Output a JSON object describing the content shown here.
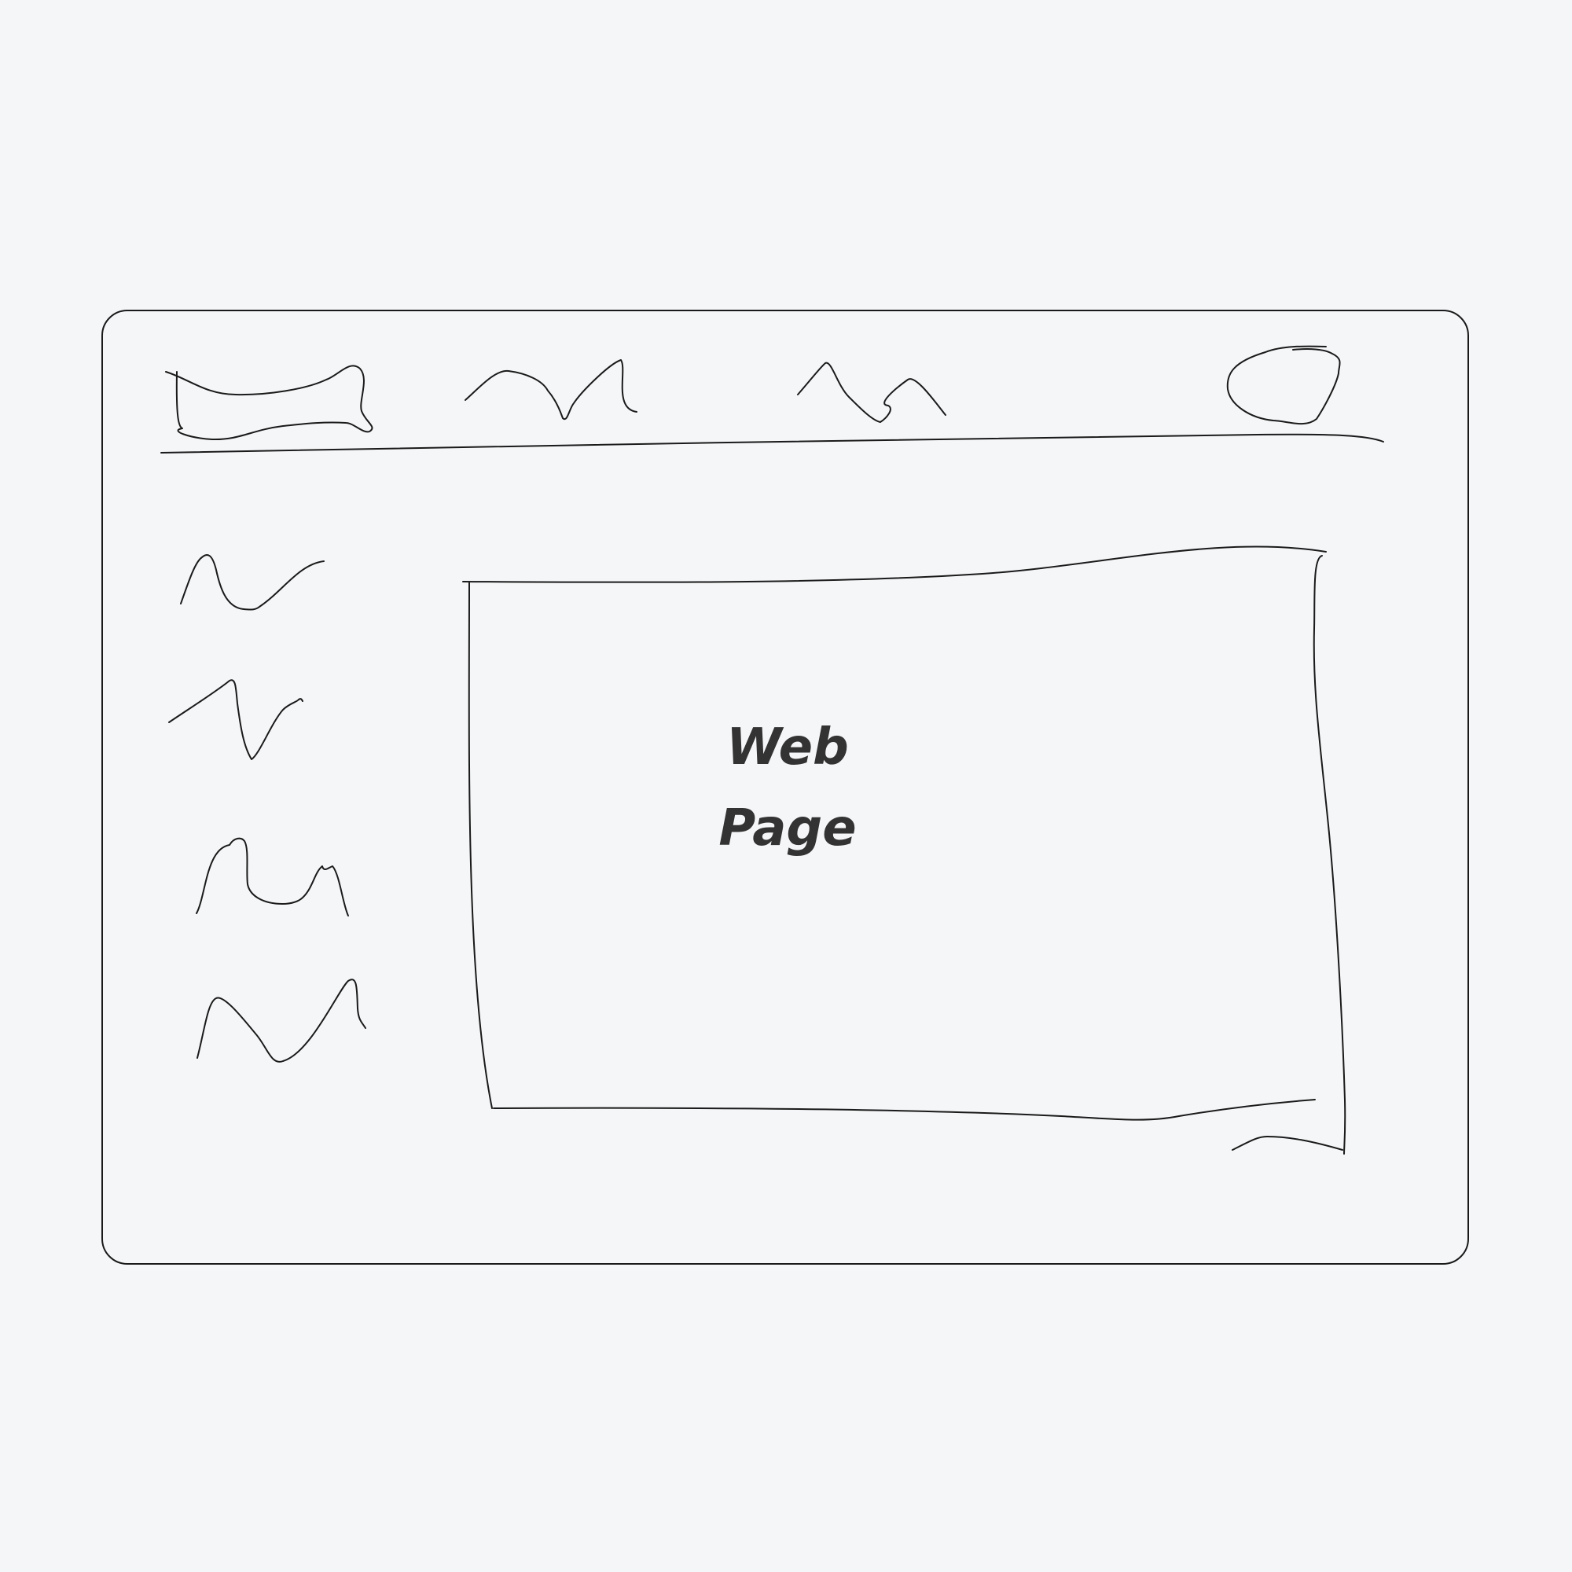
{
  "content": {
    "line1": "Web",
    "line2": "Page"
  },
  "colors": {
    "background": "#f5f6f8",
    "stroke": "#1a1a1a",
    "text": "#333333"
  }
}
